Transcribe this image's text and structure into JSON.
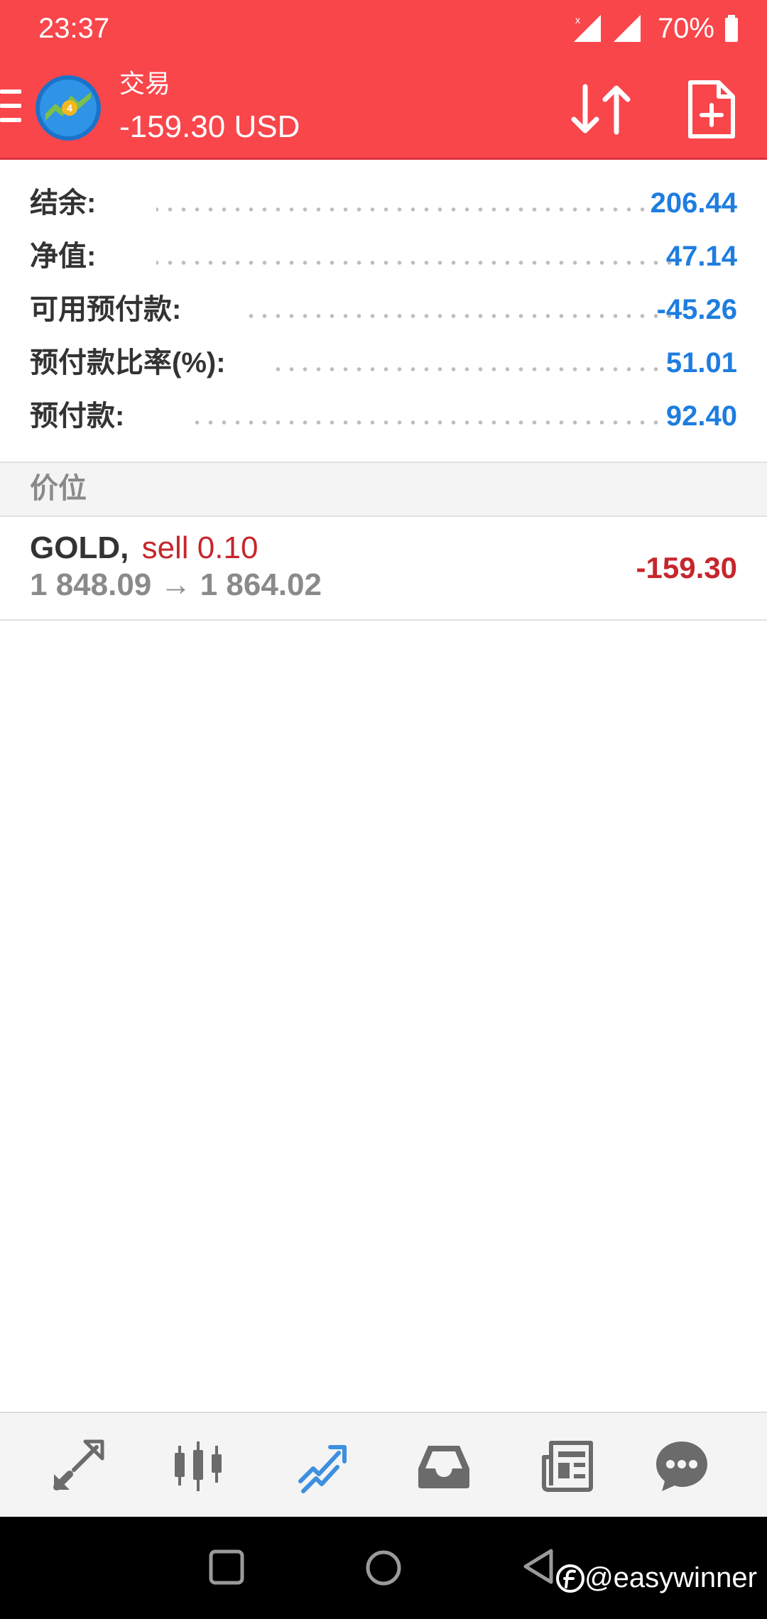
{
  "status_bar": {
    "time": "23:37",
    "battery": "70%"
  },
  "app_bar": {
    "title": "交易",
    "subtitle": "-159.30 USD"
  },
  "summary": [
    {
      "label": "结余:",
      "value": "206.44"
    },
    {
      "label": "净值:",
      "value": "47.14"
    },
    {
      "label": "可用预付款:",
      "value": "-45.26"
    },
    {
      "label": "预付款比率(%):",
      "value": "51.01"
    },
    {
      "label": "预付款:",
      "value": "92.40"
    }
  ],
  "price_section": {
    "label": "价位"
  },
  "position": {
    "symbol": "GOLD,",
    "type": "sell 0.10",
    "prices": "1 848.09 → 1 864.02",
    "profit": "-159.30"
  },
  "bottom_nav": [
    {
      "name": "quotes",
      "icon": "quotes-arrows-icon",
      "active": false
    },
    {
      "name": "chart",
      "icon": "candlestick-icon",
      "active": false
    },
    {
      "name": "trade",
      "icon": "trade-trend-icon",
      "active": true
    },
    {
      "name": "history",
      "icon": "inbox-icon",
      "active": false
    },
    {
      "name": "news",
      "icon": "newspaper-icon",
      "active": false
    },
    {
      "name": "messages",
      "icon": "chat-bubble-icon",
      "active": false
    }
  ],
  "watermark": {
    "text": "@easywinner"
  },
  "colors": {
    "accent_bar": "#f9464b",
    "value_blue": "#1e7ddf",
    "loss_red": "#c6262c",
    "nav_active": "#3d8fe0",
    "nav_inactive": "#6b6b6b"
  }
}
